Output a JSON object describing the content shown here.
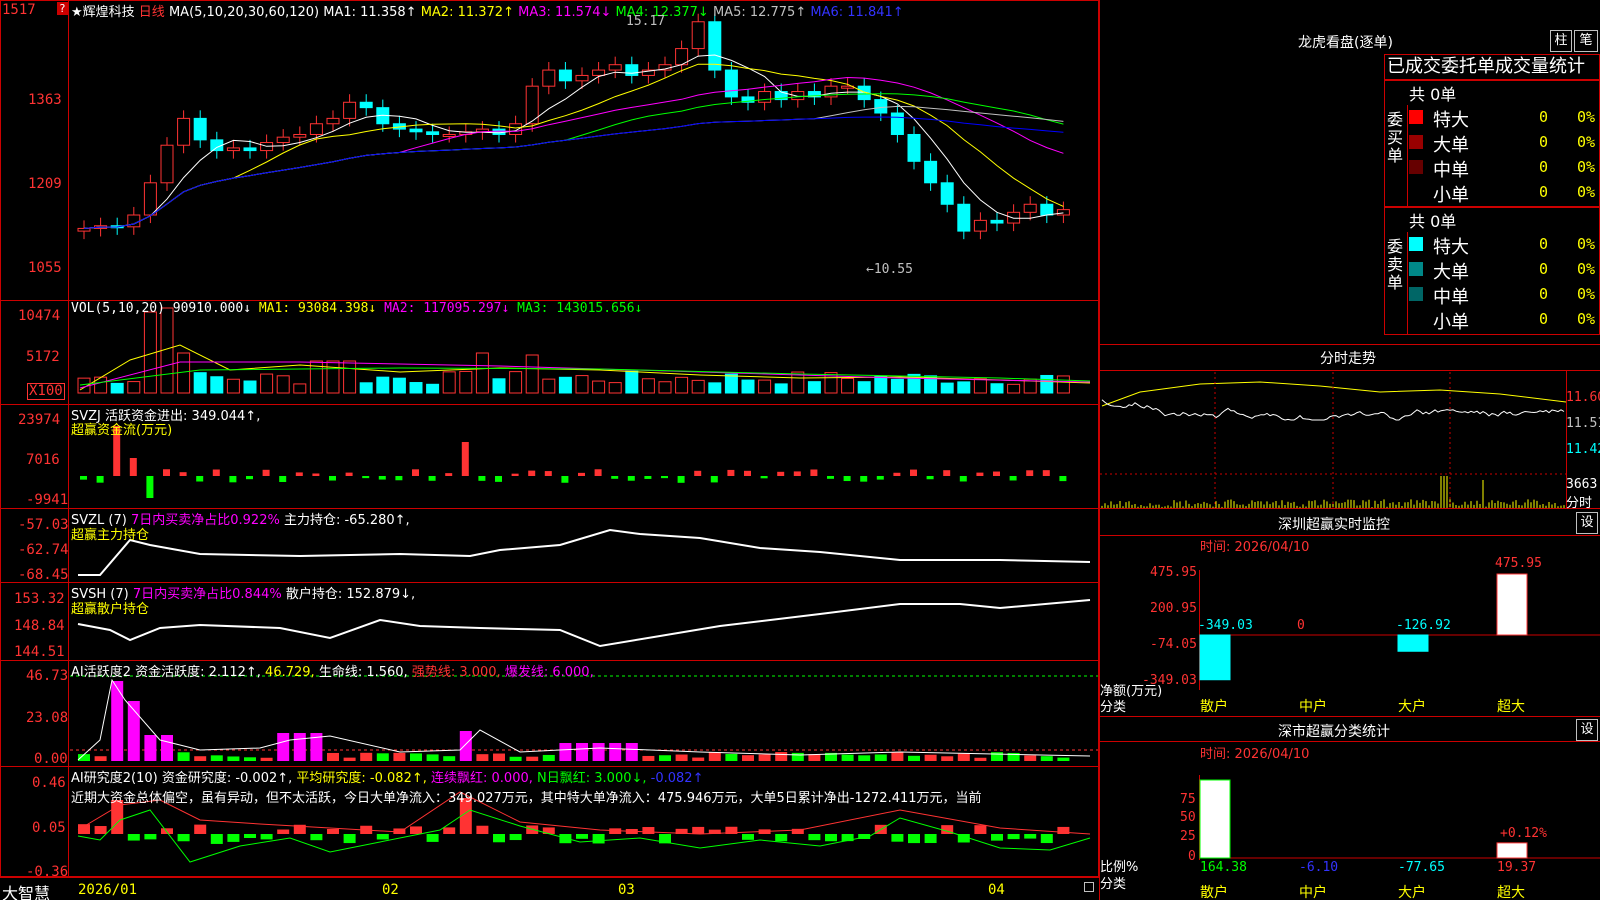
{
  "colors": {
    "up": "#ff3333",
    "down": "#00ffff",
    "frame": "#cc0000",
    "ma1": "#ffffff",
    "ma2": "#ffff00",
    "ma3": "#ff00ff",
    "ma4": "#00ff00",
    "ma5": "#c0c0c0",
    "ma6": "#0000ff",
    "green": "#00ff00",
    "magenta": "#ff00ff",
    "yellow": "#ffff00"
  },
  "price_panel": {
    "stock_name": "★辉煌科技",
    "period": "日线",
    "ma_label": "MA(5,10,20,30,60,120)",
    "ma1": "MA1: 11.358↑",
    "ma2": "MA2: 11.372↑",
    "ma3": "MA3: 11.574↓",
    "ma4": "MA4: 12.377↓",
    "ma5": "MA5: 12.775↑",
    "ma6": "MA6: 11.841↑",
    "y_ticks": [
      "1517",
      "1363",
      "1209",
      "1055"
    ],
    "high_label": "15.17",
    "low_label": "←10.55",
    "question": "?"
  },
  "vol_panel": {
    "label": "VOL(5,10,20)",
    "v": "90910.000↓",
    "ma1": "MA1: 93084.398↓",
    "ma2": "MA2: 117095.297↓",
    "ma3": "MA3: 143015.656↓",
    "y_ticks": [
      "10474",
      "5172"
    ],
    "unit": "X100"
  },
  "svzj_panel": {
    "name": "SVZJ",
    "desc": "活跃资金进出: 349.044↑,",
    "title": "超赢资金流(万元)",
    "y_ticks": [
      "23974",
      "7016",
      "-9941"
    ]
  },
  "svzl_panel": {
    "name": "SVZL (7)",
    "desc": "7日内买卖净占比0.922%",
    "hold": "主力持仓: -65.280↑,",
    "title": "超赢主力持仓",
    "y_ticks": [
      "-57.03",
      "-62.74",
      "-68.45"
    ]
  },
  "svsh_panel": {
    "name": "SVSH (7)",
    "desc": "7日内买卖净占比0.844%",
    "hold": "散户持仓: 152.879↓,",
    "title": "超赢散户持仓",
    "y_ticks": [
      "153.32",
      "148.84",
      "144.51"
    ]
  },
  "ai_active_panel": {
    "name": "AI活跃度2",
    "activity": "资金活跃度: 2.112↑,",
    "val2": "46.729,",
    "life": "生命线: 1.560,",
    "strong": "强势线: 3.000,",
    "burst": "爆发线: 6.000,",
    "y_ticks": [
      "46.73",
      "23.08",
      "0.00"
    ]
  },
  "ai_research_panel": {
    "name": "AI研究度2(10)",
    "research": "资金研究度: -0.002↑,",
    "avg": "平均研究度: -0.082↑,",
    "cont": "连续飘红: 0.000,",
    "nday": "N日飘红: 3.000↓,",
    "last": "-0.082↑",
    "comment": "近期大资金总体偏空，虽有异动，但不太活跃，今日大单净流入：349.027万元，其中特大单净流入：475.946万元，大单5日累计净出-1272.411万元，当前",
    "y_ticks": [
      "0.46",
      "0.05",
      "-0.36"
    ]
  },
  "bottom_bar": {
    "brand": "大智慧",
    "dates": [
      "2026/01",
      "02",
      "03",
      "04"
    ]
  },
  "lhb_panel": {
    "title": "龙虎看盘(逐单)",
    "btn_bar": "柱",
    "btn_pen": "笔",
    "tabs": "已成交委托单成交量统计",
    "buy": {
      "total": "共 0单",
      "side": "委买单",
      "rows": [
        {
          "label": "特大",
          "count": "0",
          "pct": "0%",
          "color": "#ff0000"
        },
        {
          "label": "大单",
          "count": "0",
          "pct": "0%",
          "color": "#990000"
        },
        {
          "label": "中单",
          "count": "0",
          "pct": "0%",
          "color": "#660000"
        },
        {
          "label": "小单",
          "count": "0",
          "pct": "0%",
          "color": "#000000"
        }
      ]
    },
    "sell": {
      "total": "共 0单",
      "side": "委卖单",
      "rows": [
        {
          "label": "特大",
          "count": "0",
          "pct": "0%",
          "color": "#00ffff"
        },
        {
          "label": "大单",
          "count": "0",
          "pct": "0%",
          "color": "#008888"
        },
        {
          "label": "中单",
          "count": "0",
          "pct": "0%",
          "color": "#006666"
        },
        {
          "label": "小单",
          "count": "0",
          "pct": "0%",
          "color": "#000000"
        }
      ]
    }
  },
  "intraday_panel": {
    "title": "分时走势",
    "y_ticks": [
      "11.60",
      "11.51",
      "11.42"
    ],
    "vol_max": "3663",
    "vol_unit": "分时"
  },
  "sz_monitor": {
    "title": "深圳超赢实时监控",
    "settings": "设",
    "time": "时间: 2026/04/10",
    "y_ticks": [
      "475.95",
      "200.95",
      "-74.05",
      "-349.03"
    ],
    "unit_label": "净额(万元)",
    "cat_label": "分类",
    "categories": [
      "散户",
      "中户",
      "大户",
      "超大"
    ],
    "values": [
      "-349.03",
      "0",
      "-126.92",
      "475.95"
    ],
    "values_num": [
      -349.03,
      0,
      -126.92,
      475.95
    ]
  },
  "sz_class": {
    "title": "深市超赢分类统计",
    "settings": "设",
    "time": "时间: 2026/04/10",
    "y_ticks": [
      "75",
      "50",
      "25",
      "0"
    ],
    "unit_label": "比例%",
    "cat_label": "分类",
    "categories": [
      "散户",
      "中户",
      "大户",
      "超大"
    ],
    "values": [
      "164.38",
      "-6.10",
      "-77.65",
      "19.37"
    ],
    "values_num": [
      164.38,
      -6.1,
      -77.65,
      19.37
    ],
    "super_change": "+0.12%"
  }
}
